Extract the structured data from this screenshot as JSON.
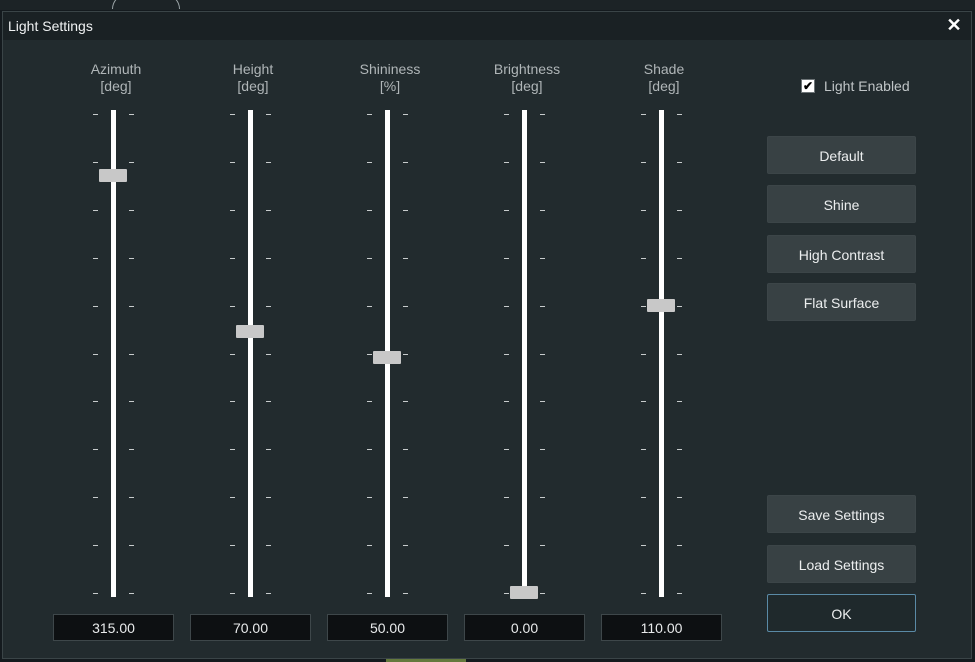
{
  "window": {
    "title": "Light Settings",
    "close_glyph": "✕"
  },
  "sliders": [
    {
      "label": "Azimuth",
      "unit": "[deg]",
      "value": "315.00",
      "position": 0.871
    },
    {
      "label": "Height",
      "unit": "[deg]",
      "value": "70.00",
      "position": 0.545
    },
    {
      "label": "Shininess",
      "unit": "[%]",
      "value": "50.00",
      "position": 0.491
    },
    {
      "label": "Brightness",
      "unit": "[deg]",
      "value": "0.00",
      "position": 0.0
    },
    {
      "label": "Shade",
      "unit": "[deg]",
      "value": "110.00",
      "position": 0.599
    }
  ],
  "light_enabled": {
    "label": "Light Enabled",
    "checked": true,
    "check_glyph": "✔"
  },
  "presets": {
    "default": "Default",
    "shine": "Shine",
    "high_contrast": "High Contrast",
    "flat_surface": "Flat Surface"
  },
  "actions": {
    "save": "Save Settings",
    "load": "Load Settings",
    "ok": "OK"
  },
  "colors": {
    "accent_border": "#5a8aa6",
    "dialog_bg": "#222b2e"
  }
}
